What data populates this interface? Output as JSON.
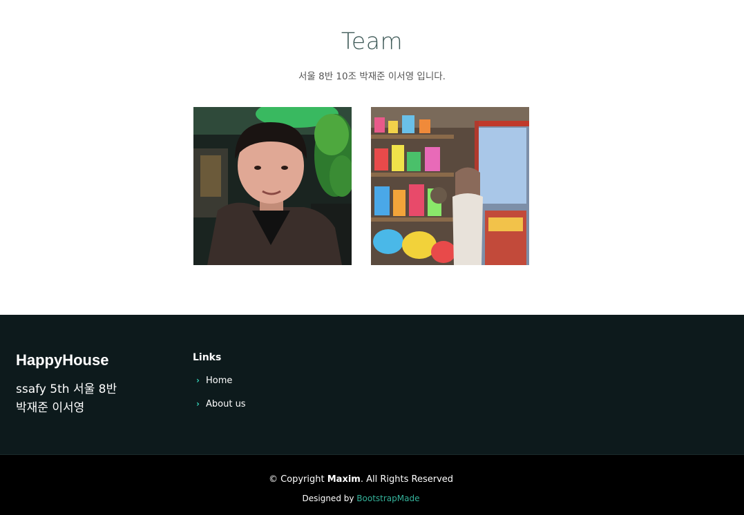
{
  "team": {
    "title": "Team",
    "subtitle": "서울 8반 10조 박재준 이서영 입니다."
  },
  "footer": {
    "brand": "HappyHouse",
    "description_line1": "ssafy 5th 서울 8반",
    "description_line2": "박재준 이서영",
    "links_title": "Links",
    "links": [
      {
        "label": "Home"
      },
      {
        "label": "About us"
      }
    ],
    "copyright_prefix": "© Copyright",
    "copyright_name": "Maxim",
    "copyright_suffix": ". All Rights Reserved",
    "designed_by_prefix": "Designed by",
    "designed_by_link": "BootstrapMade",
    "accent_color": "#34d0b6"
  }
}
